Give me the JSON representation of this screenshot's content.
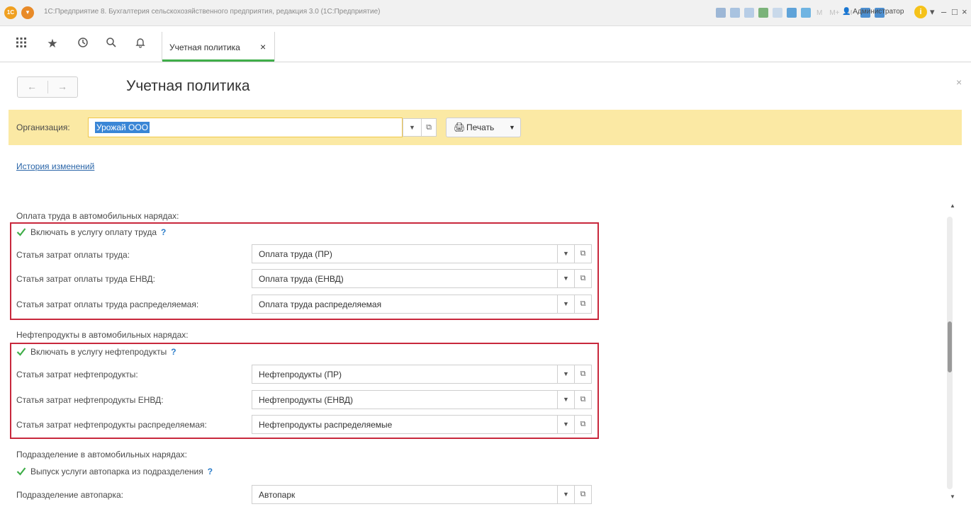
{
  "titlebar": {
    "logo_text": "1С",
    "title": "1С:Предприятие 8. Бухгалтерия сельскохозяйственного предприятия, редакция 3.0  (1С:Предприятие)",
    "memory_labels": [
      "M",
      "M+",
      "M-"
    ],
    "user": "Администратор",
    "info_glyph": "i",
    "minimize_glyph": "–",
    "maximize_glyph": "□",
    "close_glyph": "×"
  },
  "navbar": {
    "icons": [
      "apps-grid-icon",
      "star-icon",
      "history-icon",
      "search-icon",
      "bell-icon"
    ],
    "active_tab": {
      "label": "Учетная политика",
      "close_glyph": "×"
    }
  },
  "form": {
    "back_glyph": "←",
    "forward_glyph": "→",
    "title": "Учетная политика",
    "close_glyph": "×",
    "organization_label": "Организация:",
    "organization_value": "Урожай ООО",
    "print_label": "Печать",
    "history_link": "История изменений"
  },
  "sections": [
    {
      "title": "Оплата труда в автомобильных нарядах:",
      "checkbox_label": "Включать в услугу оплату труда",
      "checked": true,
      "highlighted": true,
      "fields": [
        {
          "label": "Статья затрат оплаты труда:",
          "value": "Оплата труда (ПР)"
        },
        {
          "label": "Статья затрат оплаты труда ЕНВД:",
          "value": "Оплата труда (ЕНВД)"
        },
        {
          "label": "Статья затрат оплаты труда распределяемая:",
          "value": "Оплата труда распределяемая"
        }
      ]
    },
    {
      "title": "Нефтепродукты в автомобильных нарядах:",
      "checkbox_label": "Включать в услугу нефтепродукты",
      "checked": true,
      "highlighted": true,
      "fields": [
        {
          "label": "Статья затрат нефтепродукты:",
          "value": "Нефтепродукты (ПР)"
        },
        {
          "label": "Статья затрат нефтепродукты ЕНВД:",
          "value": "Нефтепродукты (ЕНВД)"
        },
        {
          "label": "Статья затрат нефтепродукты распределяемая:",
          "value": "Нефтепродукты распределяемые"
        }
      ]
    },
    {
      "title": "Подразделение в автомобильных нарядах:",
      "checkbox_label": "Выпуск услуги автопарка из подразделения",
      "checked": true,
      "highlighted": false,
      "fields": [
        {
          "label": "Подразделение автопарка:",
          "value": "Автопарк"
        }
      ]
    }
  ],
  "help_glyph": "?",
  "colors": {
    "accent_green": "#3fae49",
    "highlight_red": "#c8283c",
    "org_panel_yellow": "#fbe9a4",
    "link_blue": "#2a65a8"
  }
}
